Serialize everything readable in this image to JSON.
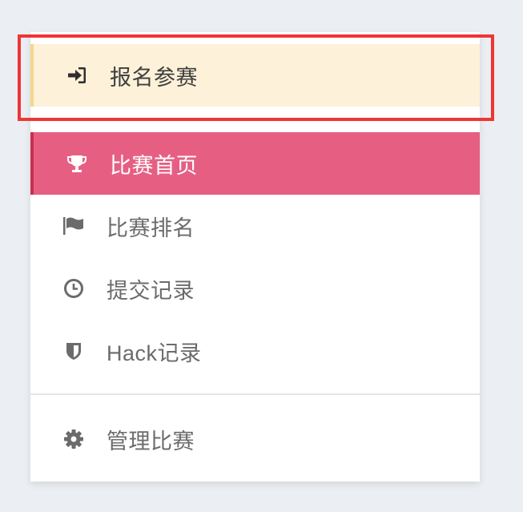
{
  "menu": {
    "join_label": "报名参赛",
    "home_label": "比赛首页",
    "rank_label": "比赛排名",
    "submissions_label": "提交记录",
    "hack_label": "Hack记录",
    "admin_label": "管理比赛"
  },
  "icons": {
    "join": "sign-in-icon",
    "home": "trophy-icon",
    "rank": "flag-icon",
    "submissions": "clock-icon",
    "hack": "shield-icon",
    "admin": "gear-icon"
  },
  "colors": {
    "join_bg": "#fdf1d9",
    "active_bg": "#e65f82",
    "highlight": "#f03535"
  }
}
